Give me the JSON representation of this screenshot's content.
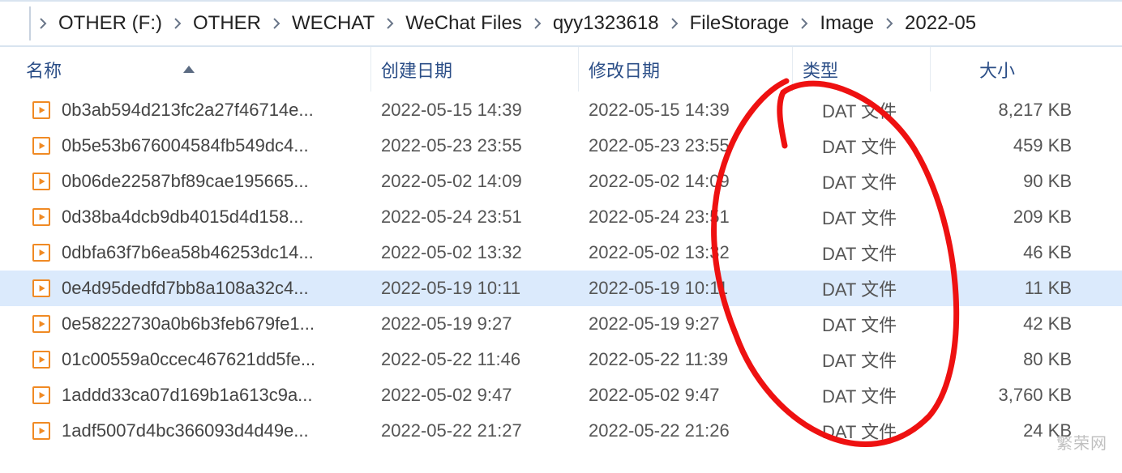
{
  "breadcrumb": [
    "OTHER (F:)",
    "OTHER",
    "WECHAT",
    "WeChat Files",
    "qyy1323618",
    "FileStorage",
    "Image",
    "2022-05"
  ],
  "columns": {
    "name": "名称",
    "created": "创建日期",
    "modified": "修改日期",
    "type": "类型",
    "size": "大小"
  },
  "files": [
    {
      "name": "0b3ab594d213fc2a27f46714e...",
      "created": "2022-05-15 14:39",
      "modified": "2022-05-15 14:39",
      "type": "DAT 文件",
      "size": "8,217 KB",
      "selected": false
    },
    {
      "name": "0b5e53b676004584fb549dc4...",
      "created": "2022-05-23 23:55",
      "modified": "2022-05-23 23:55",
      "type": "DAT 文件",
      "size": "459 KB",
      "selected": false
    },
    {
      "name": "0b06de22587bf89cae195665...",
      "created": "2022-05-02 14:09",
      "modified": "2022-05-02 14:09",
      "type": "DAT 文件",
      "size": "90 KB",
      "selected": false
    },
    {
      "name": "0d38ba4dcb9db4015d4d158...",
      "created": "2022-05-24 23:51",
      "modified": "2022-05-24 23:51",
      "type": "DAT 文件",
      "size": "209 KB",
      "selected": false
    },
    {
      "name": "0dbfa63f7b6ea58b46253dc14...",
      "created": "2022-05-02 13:32",
      "modified": "2022-05-02 13:32",
      "type": "DAT 文件",
      "size": "46 KB",
      "selected": false
    },
    {
      "name": "0e4d95dedfd7bb8a108a32c4...",
      "created": "2022-05-19 10:11",
      "modified": "2022-05-19 10:11",
      "type": "DAT 文件",
      "size": "11 KB",
      "selected": true
    },
    {
      "name": "0e58222730a0b6b3feb679fe1...",
      "created": "2022-05-19 9:27",
      "modified": "2022-05-19 9:27",
      "type": "DAT 文件",
      "size": "42 KB",
      "selected": false
    },
    {
      "name": "01c00559a0ccec467621dd5fe...",
      "created": "2022-05-22 11:46",
      "modified": "2022-05-22 11:39",
      "type": "DAT 文件",
      "size": "80 KB",
      "selected": false
    },
    {
      "name": "1addd33ca07d169b1a613c9a...",
      "created": "2022-05-02 9:47",
      "modified": "2022-05-02 9:47",
      "type": "DAT 文件",
      "size": "3,760 KB",
      "selected": false
    },
    {
      "name": "1adf5007d4bc366093d4d49e...",
      "created": "2022-05-22 21:27",
      "modified": "2022-05-22 21:26",
      "type": "DAT 文件",
      "size": "24 KB",
      "selected": false
    }
  ],
  "watermark": "繁荣网"
}
